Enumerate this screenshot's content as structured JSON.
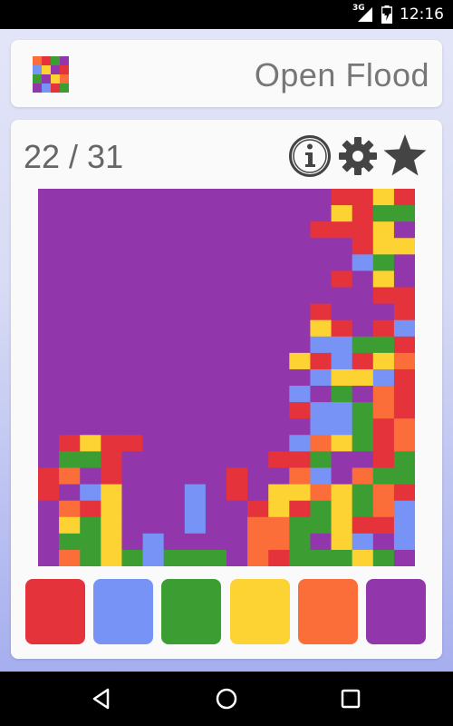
{
  "status_bar": {
    "network_label": "3G",
    "time": "12:16",
    "icons": [
      "signal-icon",
      "battery-charging-icon"
    ]
  },
  "app": {
    "title": "Open Flood",
    "logo_icon": "mosaic-logo-icon"
  },
  "game": {
    "moves_display": "22 / 31",
    "moves_used": 22,
    "moves_max": 31,
    "toolbar_icons": [
      "info-icon",
      "gear-icon",
      "star-icon"
    ],
    "board_size": 18,
    "colors": {
      "R": "#e5333b",
      "B": "#7893f6",
      "G": "#3c9e32",
      "Y": "#fdd233",
      "O": "#fb6e3a",
      "P": "#9236ab"
    },
    "board": [
      "PPPPPPPPPPPPPPRRYR",
      "PPPPPPPPPPPPPPYRGG",
      "PPPPPPPPPPPPPRRRYP",
      "PPPPPPPPPPPPPPPRYY",
      "PPPPPPPPPPPPPPPBGP",
      "PPPPPPPPPPPPPPRPYP",
      "PPPPPPPPPPPPPPPPRR",
      "PPPPPPPPPPPPPRPPPR",
      "PPPPPPPPPPPPPYRPRB",
      "PPPPPPPPPPPPPBBGGR",
      "PPPPPPPPPPPPYRBRYO",
      "PPPPPPPPPPPPPBYYBR",
      "PPPPPPPPPPPPBPGPOR",
      "PPPPPPPPPPPPRBBGOR",
      "PPPPPPPPPPPPPBBGRO",
      "PRYRRPPPPPPPBOYGRO",
      "PGGRPPPPPPPRRGPPRG",
      "ROPRPPPPPRPPOBPOGG",
      "RPBYPPPBPRPYYOYGOR",
      "PORYPPPBPPRYRGYGOB",
      "PYGYPPPBPPOOGGYRRB",
      "PGGYPBPPPPOOGPYBPB",
      "POGYGBGGGPORGGGYGP"
    ],
    "palette": [
      {
        "name": "red",
        "color": "#e5333b"
      },
      {
        "name": "blue",
        "color": "#7893f6"
      },
      {
        "name": "green",
        "color": "#3c9e32"
      },
      {
        "name": "yellow",
        "color": "#fdd233"
      },
      {
        "name": "orange",
        "color": "#fb6e3a"
      },
      {
        "name": "purple",
        "color": "#9236ab"
      }
    ]
  },
  "nav_bar": {
    "icons": [
      "back-icon",
      "home-icon",
      "recents-icon"
    ]
  }
}
